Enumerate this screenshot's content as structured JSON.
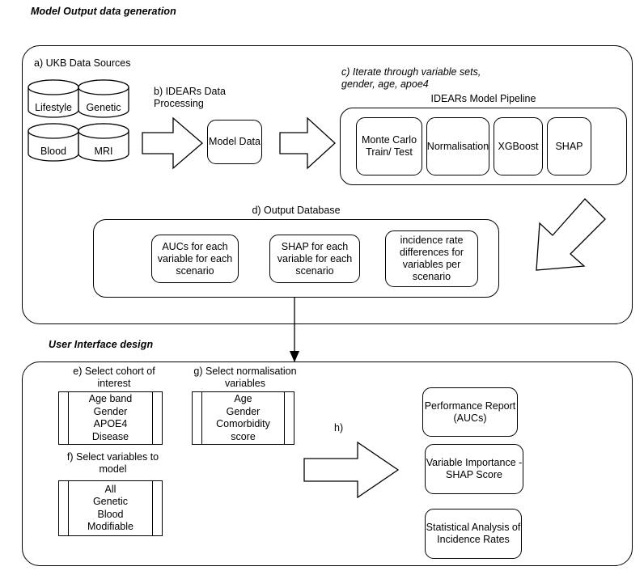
{
  "sections": {
    "top_title": "Model Output data generation",
    "bottom_title": "User Interface design"
  },
  "top_panel": {
    "a_label": "a) UKB Data Sources",
    "sources": [
      {
        "name": "Lifestyle"
      },
      {
        "name": "Genetic"
      },
      {
        "name": "Blood"
      },
      {
        "name": "MRI"
      }
    ],
    "b_label": "b) IDEARs Data\nProcessing",
    "model_data": "Model Data",
    "c_label": "c) Iterate through variable sets,\n       gender, age, apoe4",
    "pipeline_title": "IDEARs Model Pipeline",
    "pipeline_steps": [
      "Monte Carlo\nTrain/ Test",
      "Normalisation",
      "XGBoost",
      "SHAP"
    ],
    "d_label": "d) Output Database",
    "outputs": [
      "AUCs for each\nvariable for each\nscenario",
      "SHAP for each\nvariable for each\nscenario",
      "incidence rate\ndifferences for\nvariables per\nscenario"
    ]
  },
  "bottom_panel": {
    "e_label": "e) Select cohort of\ninterest",
    "e_items": "Age band\nGender\nAPOE4\nDisease",
    "f_label": "f) Select variables to\nmodel",
    "f_items": "All\nGenetic\nBlood\nModifiable",
    "g_label": "g) Select normalisation\nvariables",
    "g_items": "Age\nGender\nComorbidity\nscore",
    "h_label": "h)",
    "results": [
      "Performance Report\n(AUCs)",
      "Variable Importance -\nSHAP Score",
      "Statistical Analysis of\nIncidence Rates"
    ]
  },
  "colors": {
    "stroke": "#000000",
    "background": "#ffffff"
  }
}
